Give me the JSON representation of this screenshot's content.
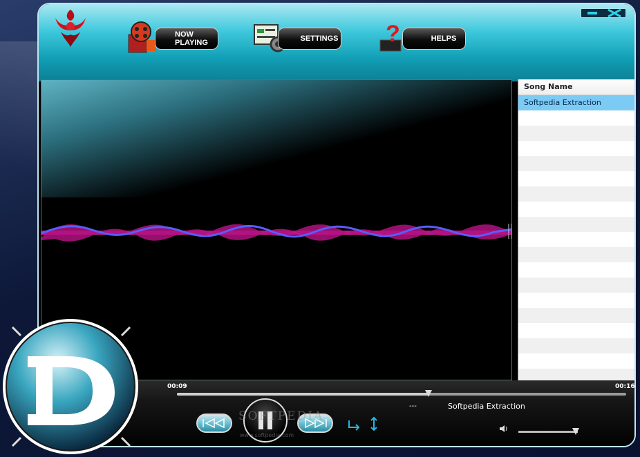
{
  "header": {
    "nav": [
      {
        "label": "NOW PLAYING",
        "icon": "film-reel-icon"
      },
      {
        "label": "SETTINGS",
        "icon": "settings-gear-icon"
      },
      {
        "label": "HELPS",
        "icon": "help-question-icon"
      }
    ],
    "window_controls": {
      "minimize_icon": "minimize-icon",
      "close_icon": "close-icon"
    }
  },
  "playlist": {
    "column_header": "Song Name",
    "items": [
      "Softpedia Extraction"
    ],
    "selected_index": 0
  },
  "player": {
    "elapsed": "00:09",
    "duration": "00:16",
    "progress": 0.56,
    "status_dash": "---",
    "now_playing_title": "Softpedia Extraction",
    "volume": 0.97
  },
  "transport": {
    "prev_icon": "previous-icon",
    "play_pause_icon": "pause-icon",
    "next_icon": "next-icon",
    "repeat_icon": "repeat-arrow-icon",
    "shuffle_icon": "vertical-arrows-icon"
  },
  "watermark": {
    "text": "SOFTPEDIA",
    "url": "www.softpedia.com"
  },
  "colors": {
    "header_accent": "#3ec8dc",
    "selected_row": "#7ccbf5",
    "wave_magenta": "#c0148c",
    "wave_blue": "#5a5cff"
  }
}
